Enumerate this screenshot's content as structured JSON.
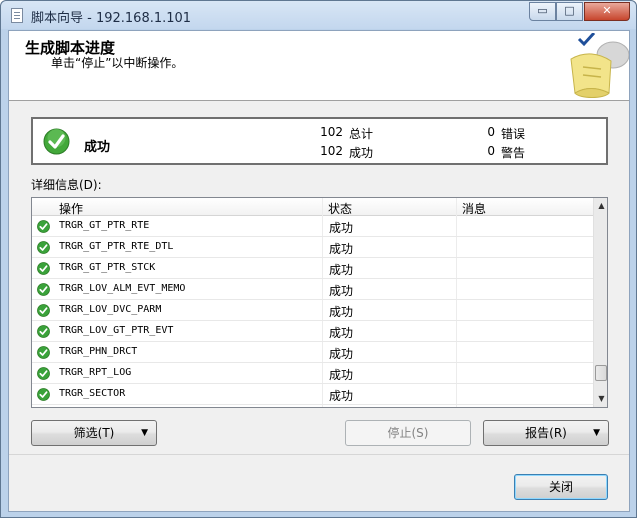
{
  "window": {
    "title": "脚本向导 - 192.168.1.101"
  },
  "caption": {
    "minimize": "▭",
    "maximize": "□",
    "close": "✕"
  },
  "header": {
    "title": "生成脚本进度",
    "subtitle": "单击“停止”以中断操作。"
  },
  "summary": {
    "status": "成功",
    "total_count": "102",
    "total_label": "总计",
    "success_count": "102",
    "success_label": "成功",
    "error_count": "0",
    "error_label": "错误",
    "warning_count": "0",
    "warning_label": "警告"
  },
  "details": {
    "label": "详细信息(D):",
    "columns": {
      "operation": "操作",
      "status": "状态",
      "message": "消息"
    },
    "rows": [
      {
        "operation": "TRGR_GT_PTR_RTE",
        "status": "成功",
        "message": ""
      },
      {
        "operation": "TRGR_GT_PTR_RTE_DTL",
        "status": "成功",
        "message": ""
      },
      {
        "operation": "TRGR_GT_PTR_STCK",
        "status": "成功",
        "message": ""
      },
      {
        "operation": "TRGR_LOV_ALM_EVT_MEMO",
        "status": "成功",
        "message": ""
      },
      {
        "operation": "TRGR_LOV_DVC_PARM",
        "status": "成功",
        "message": ""
      },
      {
        "operation": "TRGR_LOV_GT_PTR_EVT",
        "status": "成功",
        "message": ""
      },
      {
        "operation": "TRGR_PHN_DRCT",
        "status": "成功",
        "message": ""
      },
      {
        "operation": "TRGR_RPT_LOG",
        "status": "成功",
        "message": ""
      },
      {
        "operation": "TRGR_SECTOR",
        "status": "成功",
        "message": ""
      }
    ],
    "scroll_position": 0.95
  },
  "buttons": {
    "filter": "筛选(T)",
    "stop": "停止(S)",
    "report": "报告(R)",
    "close": "关闭",
    "dropdown_arrow": "▼"
  },
  "icons": {
    "success": "check-circle-icon",
    "success_color": "#3aa23a"
  }
}
